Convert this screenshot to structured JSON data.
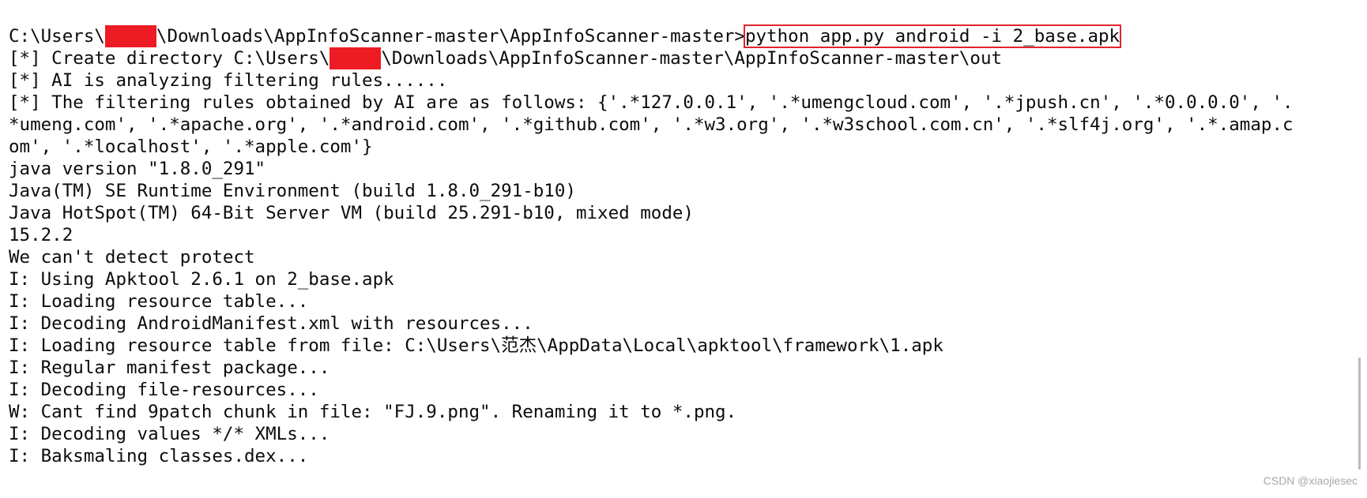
{
  "terminal": {
    "prompt_prefix": "C:\\Users\\",
    "prompt_path": "\\Downloads\\AppInfoScanner-master\\AppInfoScanner-master>",
    "command": "python app.py android -i 2_base.apk",
    "create_prefix": "[*] Create directory C:\\Users\\",
    "create_path": "\\Downloads\\AppInfoScanner-master\\AppInfoScanner-master\\out",
    "lines": [
      "[*] AI is analyzing filtering rules......",
      "[*] The filtering rules obtained by AI are as follows: {'.*127.0.0.1', '.*umengcloud.com', '.*jpush.cn', '.*0.0.0.0', '.",
      "*umeng.com', '.*apache.org', '.*android.com', '.*github.com', '.*w3.org', '.*w3school.com.cn', '.*slf4j.org', '.*.amap.c",
      "om', '.*localhost', '.*apple.com'}",
      "java version \"1.8.0_291\"",
      "Java(TM) SE Runtime Environment (build 1.8.0_291-b10)",
      "Java HotSpot(TM) 64-Bit Server VM (build 25.291-b10, mixed mode)",
      "15.2.2",
      "We can't detect protect",
      "I: Using Apktool 2.6.1 on 2_base.apk",
      "I: Loading resource table...",
      "I: Decoding AndroidManifest.xml with resources...",
      "I: Loading resource table from file: C:\\Users\\范杰\\AppData\\Local\\apktool\\framework\\1.apk",
      "I: Regular manifest package...",
      "I: Decoding file-resources...",
      "W: Cant find 9patch chunk in file: \"FJ.9.png\". Renaming it to *.png.",
      "I: Decoding values */* XMLs...",
      "I: Baksmaling classes.dex..."
    ]
  },
  "watermark": "CSDN @xiaojiesec",
  "colors": {
    "text": "#0c0c0c",
    "redaction": "#ed1c24",
    "highlight_border": "#e0242b",
    "background": "#ffffff"
  }
}
